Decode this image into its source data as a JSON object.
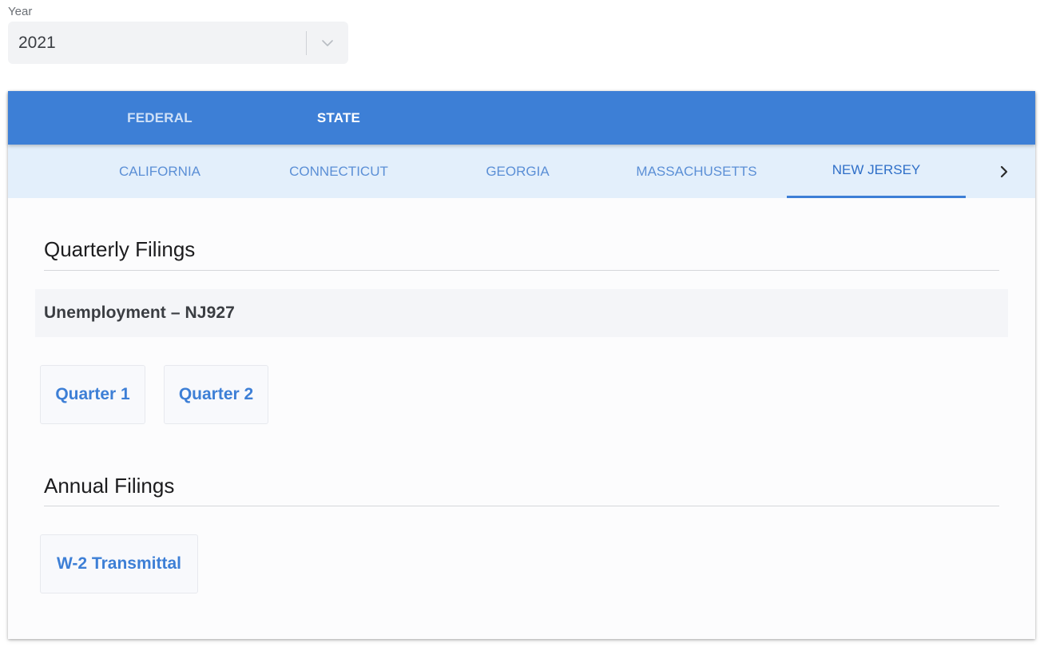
{
  "year": {
    "label": "Year",
    "selected": "2021"
  },
  "primary_tabs": [
    {
      "label": "FEDERAL",
      "active": false
    },
    {
      "label": "STATE",
      "active": true
    }
  ],
  "state_tabs": [
    {
      "label": "CALIFORNIA",
      "active": false
    },
    {
      "label": "CONNECTICUT",
      "active": false
    },
    {
      "label": "GEORGIA",
      "active": false
    },
    {
      "label": "MASSACHUSETTS",
      "active": false
    },
    {
      "label": "NEW JERSEY",
      "active": true
    }
  ],
  "quarterly": {
    "title": "Quarterly Filings",
    "filing_name": "Unemployment – NJ927",
    "buttons": [
      "Quarter 1",
      "Quarter 2"
    ]
  },
  "annual": {
    "title": "Annual Filings",
    "buttons": [
      "W-2 Transmittal"
    ]
  },
  "colors": {
    "primary": "#3d7fd6",
    "secondary_bar": "#e3effb",
    "link": "#3d7fd6"
  },
  "icons": {
    "year_dropdown": "chevron-down-icon",
    "tabs_next": "chevron-right-icon"
  }
}
